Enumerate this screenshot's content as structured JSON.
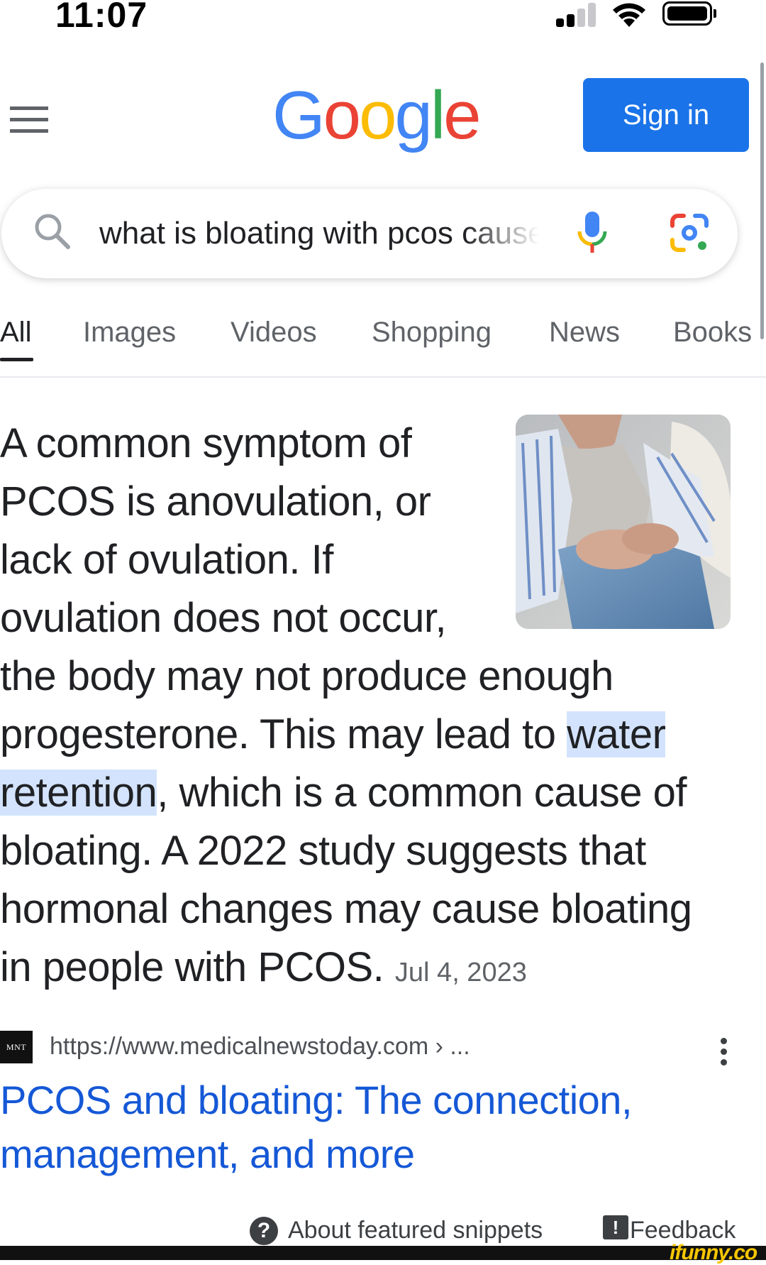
{
  "status_bar": {
    "time": "11:07"
  },
  "header": {
    "logo_letters": [
      {
        "char": "G",
        "color": "#4285f4"
      },
      {
        "char": "o",
        "color": "#ea4335"
      },
      {
        "char": "o",
        "color": "#fbbc05"
      },
      {
        "char": "g",
        "color": "#4285f4"
      },
      {
        "char": "l",
        "color": "#34a853"
      },
      {
        "char": "e",
        "color": "#ea4335"
      }
    ],
    "sign_in_label": "Sign in"
  },
  "search": {
    "query": "what is bloating with pcos cause"
  },
  "tabs": [
    "All",
    "Images",
    "Videos",
    "Shopping",
    "News",
    "Books"
  ],
  "active_tab": "All",
  "snippet": {
    "text_before": "A common symptom of PCOS is anovulation, or lack of ovulation. If ovulation does not occur, the body may not produce enough progesterone. This may lead to ",
    "highlight": "water retention",
    "text_after": ", which is a common cause of bloating. A 2022 study suggests that hormonal changes may cause bloating in people with PCOS.",
    "date": "Jul 4, 2023",
    "image_icon": "woman-holding-stomach-photo"
  },
  "result": {
    "site_logo": "MNT",
    "url": "https://www.medicalnewstoday.com › ...",
    "title": "PCOS and bloating: The connection, management, and more"
  },
  "footer": {
    "about_label": "About featured snippets",
    "feedback_label": "Feedback",
    "watermark": "ifunny.co"
  },
  "colors": {
    "accent": "#1a73e8",
    "link": "#1558d6",
    "highlight": "#d3e3fd"
  }
}
